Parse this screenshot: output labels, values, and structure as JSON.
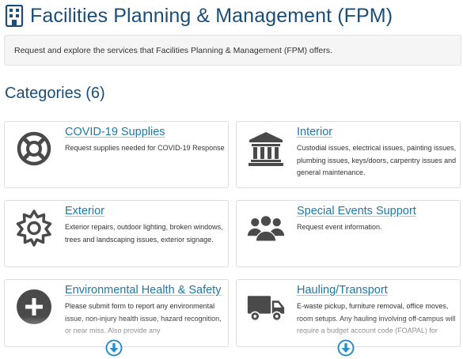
{
  "header": {
    "title": "Facilities Planning & Management (FPM)",
    "icon": "building-icon"
  },
  "description": "Request and explore the services that Facilities Planning & Management (FPM) offers.",
  "categories_heading": "Categories (6)",
  "categories": [
    {
      "title": "COVID-19 Supplies",
      "description": "Request supplies needed for COVID-19 Response",
      "icon": "lifebuoy-icon"
    },
    {
      "title": "Interior",
      "description": "Custodial issues, electrical issues, painting issues, plumbing issues, keys/doors, carpentry issues and general maintenance.",
      "icon": "institution-icon"
    },
    {
      "title": "Exterior",
      "description": "Exterior repairs, outdoor lighting, broken windows, trees and landscaping issues, exterior signage.",
      "icon": "gear-icon"
    },
    {
      "title": "Special Events Support",
      "description": "Request event information.",
      "icon": "users-icon"
    },
    {
      "title": "Environmental Health & Safety",
      "description": "Please submit form to report any environmental issue, non-injury health issue, hazard recognition, or near miss. Also provide any",
      "icon": "plus-circle-icon"
    },
    {
      "title": "Hauling/Transport",
      "description": "E-waste pickup, furniture removal, office moves, room setups. Any hauling involving off-campus will require a budget account code (FOAPAL) for",
      "icon": "truck-icon"
    }
  ],
  "colors": {
    "heading": "#1a4e78",
    "link": "#1f78a8",
    "icon": "#4a4a4a",
    "scroll_arrow": "#2a8fc9"
  },
  "scroll_icon": "arrow-down-circle-icon"
}
